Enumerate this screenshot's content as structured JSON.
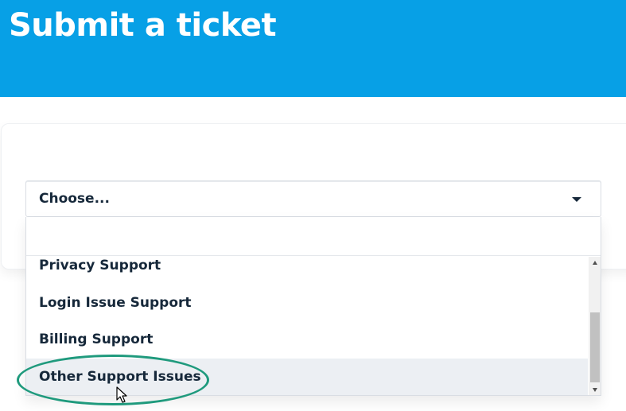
{
  "header": {
    "title": "Submit a ticket",
    "background_color": "#07a0e6"
  },
  "ticket_form": {
    "category_select": {
      "selected_value": "Choose...",
      "search_value": "",
      "options": [
        "Privacy Support",
        "Login Issue Support",
        "Billing Support",
        "Other Support Issues"
      ],
      "hovered_option": "Other Support Issues"
    }
  },
  "annotation": {
    "highlight_color": "#1f9a7d",
    "pointer": "mouse-cursor-icon"
  }
}
